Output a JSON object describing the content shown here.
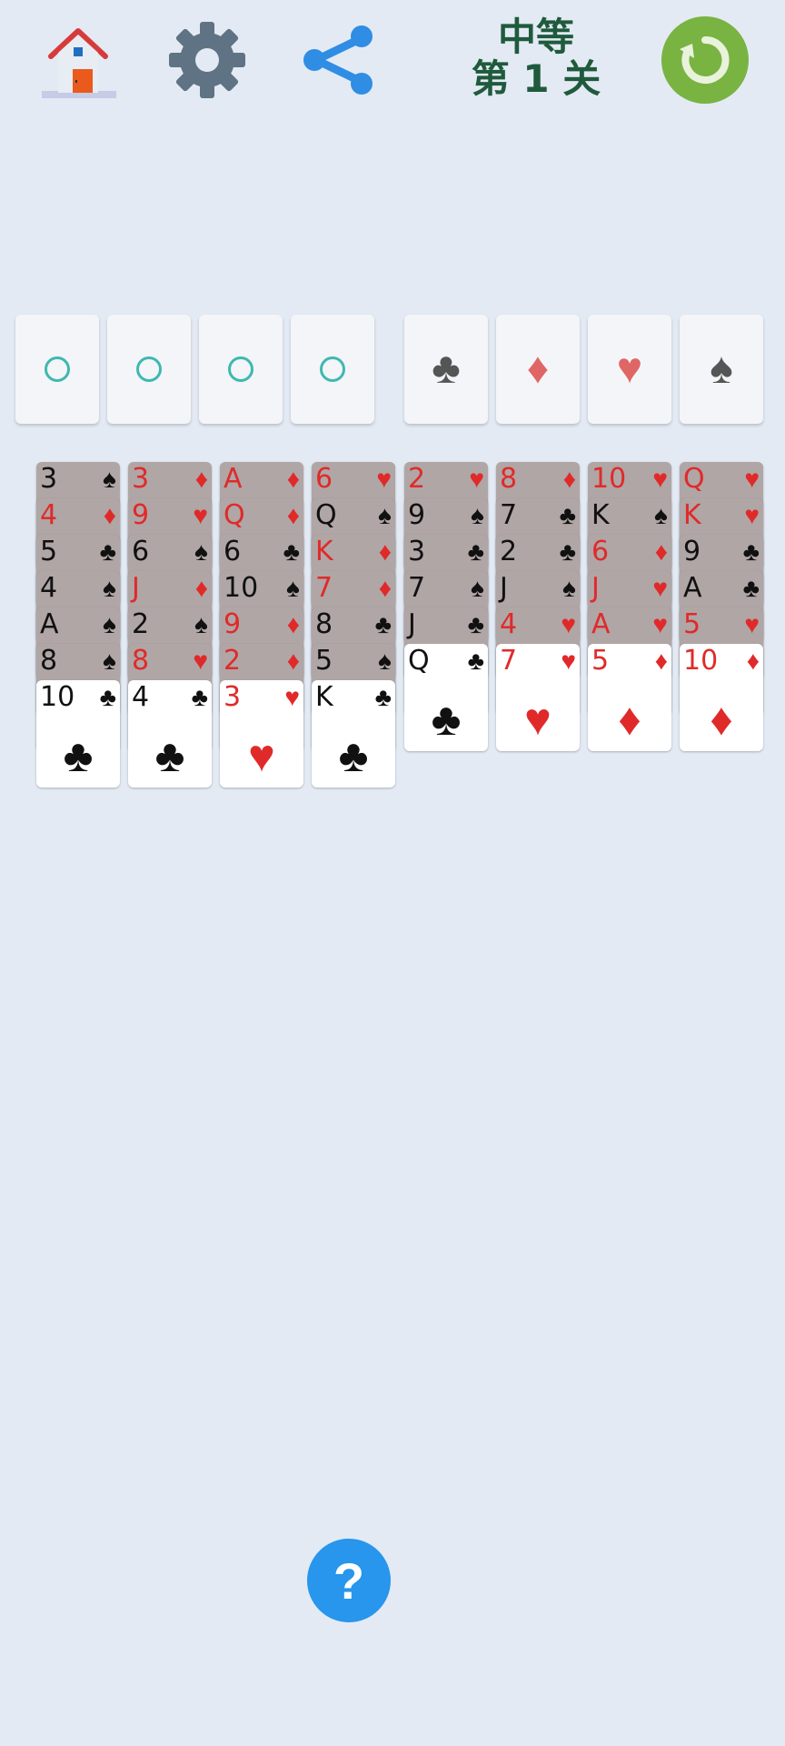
{
  "header": {
    "level_difficulty": "中等",
    "level_number": "第 1 关",
    "icons": {
      "home": "home-icon",
      "settings": "gear-icon",
      "share": "share-icon",
      "restart": "restart-icon"
    },
    "colors": {
      "restart_bg": "#79b342",
      "level_text": "#1f5a3c",
      "share": "#2f8de4",
      "gear": "#5f7384"
    }
  },
  "free_cells": [
    {
      "icon": "empty-ring-icon"
    },
    {
      "icon": "empty-ring-icon"
    },
    {
      "icon": "empty-ring-icon"
    },
    {
      "icon": "empty-ring-icon"
    }
  ],
  "foundations": [
    {
      "suit": "♣",
      "color": "#555555"
    },
    {
      "suit": "♦",
      "color": "#e06666"
    },
    {
      "suit": "♥",
      "color": "#e06666"
    },
    {
      "suit": "♠",
      "color": "#555555"
    }
  ],
  "columns": [
    {
      "cards": [
        {
          "rank": "3",
          "suit": "♠",
          "face": "down"
        },
        {
          "rank": "4",
          "suit": "♦",
          "face": "down"
        },
        {
          "rank": "5",
          "suit": "♣",
          "face": "down"
        },
        {
          "rank": "4",
          "suit": "♠",
          "face": "down"
        },
        {
          "rank": "A",
          "suit": "♠",
          "face": "down"
        },
        {
          "rank": "8",
          "suit": "♠",
          "face": "down"
        },
        {
          "rank": "10",
          "suit": "♣",
          "face": "up"
        }
      ]
    },
    {
      "cards": [
        {
          "rank": "3",
          "suit": "♦",
          "face": "down"
        },
        {
          "rank": "9",
          "suit": "♥",
          "face": "down"
        },
        {
          "rank": "6",
          "suit": "♠",
          "face": "down"
        },
        {
          "rank": "J",
          "suit": "♦",
          "face": "down"
        },
        {
          "rank": "2",
          "suit": "♠",
          "face": "down"
        },
        {
          "rank": "8",
          "suit": "♥",
          "face": "down"
        },
        {
          "rank": "4",
          "suit": "♣",
          "face": "up"
        }
      ]
    },
    {
      "cards": [
        {
          "rank": "A",
          "suit": "♦",
          "face": "down"
        },
        {
          "rank": "Q",
          "suit": "♦",
          "face": "down"
        },
        {
          "rank": "6",
          "suit": "♣",
          "face": "down"
        },
        {
          "rank": "10",
          "suit": "♠",
          "face": "down"
        },
        {
          "rank": "9",
          "suit": "♦",
          "face": "down"
        },
        {
          "rank": "2",
          "suit": "♦",
          "face": "down"
        },
        {
          "rank": "3",
          "suit": "♥",
          "face": "up"
        }
      ]
    },
    {
      "cards": [
        {
          "rank": "6",
          "suit": "♥",
          "face": "down"
        },
        {
          "rank": "Q",
          "suit": "♠",
          "face": "down"
        },
        {
          "rank": "K",
          "suit": "♦",
          "face": "down"
        },
        {
          "rank": "7",
          "suit": "♦",
          "face": "down"
        },
        {
          "rank": "8",
          "suit": "♣",
          "face": "down"
        },
        {
          "rank": "5",
          "suit": "♠",
          "face": "down"
        },
        {
          "rank": "K",
          "suit": "♣",
          "face": "up"
        }
      ]
    },
    {
      "cards": [
        {
          "rank": "2",
          "suit": "♥",
          "face": "down"
        },
        {
          "rank": "9",
          "suit": "♠",
          "face": "down"
        },
        {
          "rank": "3",
          "suit": "♣",
          "face": "down"
        },
        {
          "rank": "7",
          "suit": "♠",
          "face": "down"
        },
        {
          "rank": "J",
          "suit": "♣",
          "face": "down"
        },
        {
          "rank": "Q",
          "suit": "♣",
          "face": "up"
        }
      ]
    },
    {
      "cards": [
        {
          "rank": "8",
          "suit": "♦",
          "face": "down"
        },
        {
          "rank": "7",
          "suit": "♣",
          "face": "down"
        },
        {
          "rank": "2",
          "suit": "♣",
          "face": "down"
        },
        {
          "rank": "J",
          "suit": "♠",
          "face": "down"
        },
        {
          "rank": "4",
          "suit": "♥",
          "face": "down"
        },
        {
          "rank": "7",
          "suit": "♥",
          "face": "up"
        }
      ]
    },
    {
      "cards": [
        {
          "rank": "10",
          "suit": "♥",
          "face": "down"
        },
        {
          "rank": "K",
          "suit": "♠",
          "face": "down"
        },
        {
          "rank": "6",
          "suit": "♦",
          "face": "down"
        },
        {
          "rank": "J",
          "suit": "♥",
          "face": "down"
        },
        {
          "rank": "A",
          "suit": "♥",
          "face": "down"
        },
        {
          "rank": "5",
          "suit": "♦",
          "face": "up"
        }
      ]
    },
    {
      "cards": [
        {
          "rank": "Q",
          "suit": "♥",
          "face": "down"
        },
        {
          "rank": "K",
          "suit": "♥",
          "face": "down"
        },
        {
          "rank": "9",
          "suit": "♣",
          "face": "down"
        },
        {
          "rank": "A",
          "suit": "♣",
          "face": "down"
        },
        {
          "rank": "5",
          "suit": "♥",
          "face": "down"
        },
        {
          "rank": "10",
          "suit": "♦",
          "face": "up"
        }
      ]
    }
  ],
  "help": {
    "label": "?",
    "icon": "help-icon",
    "color": "#2796ec"
  }
}
